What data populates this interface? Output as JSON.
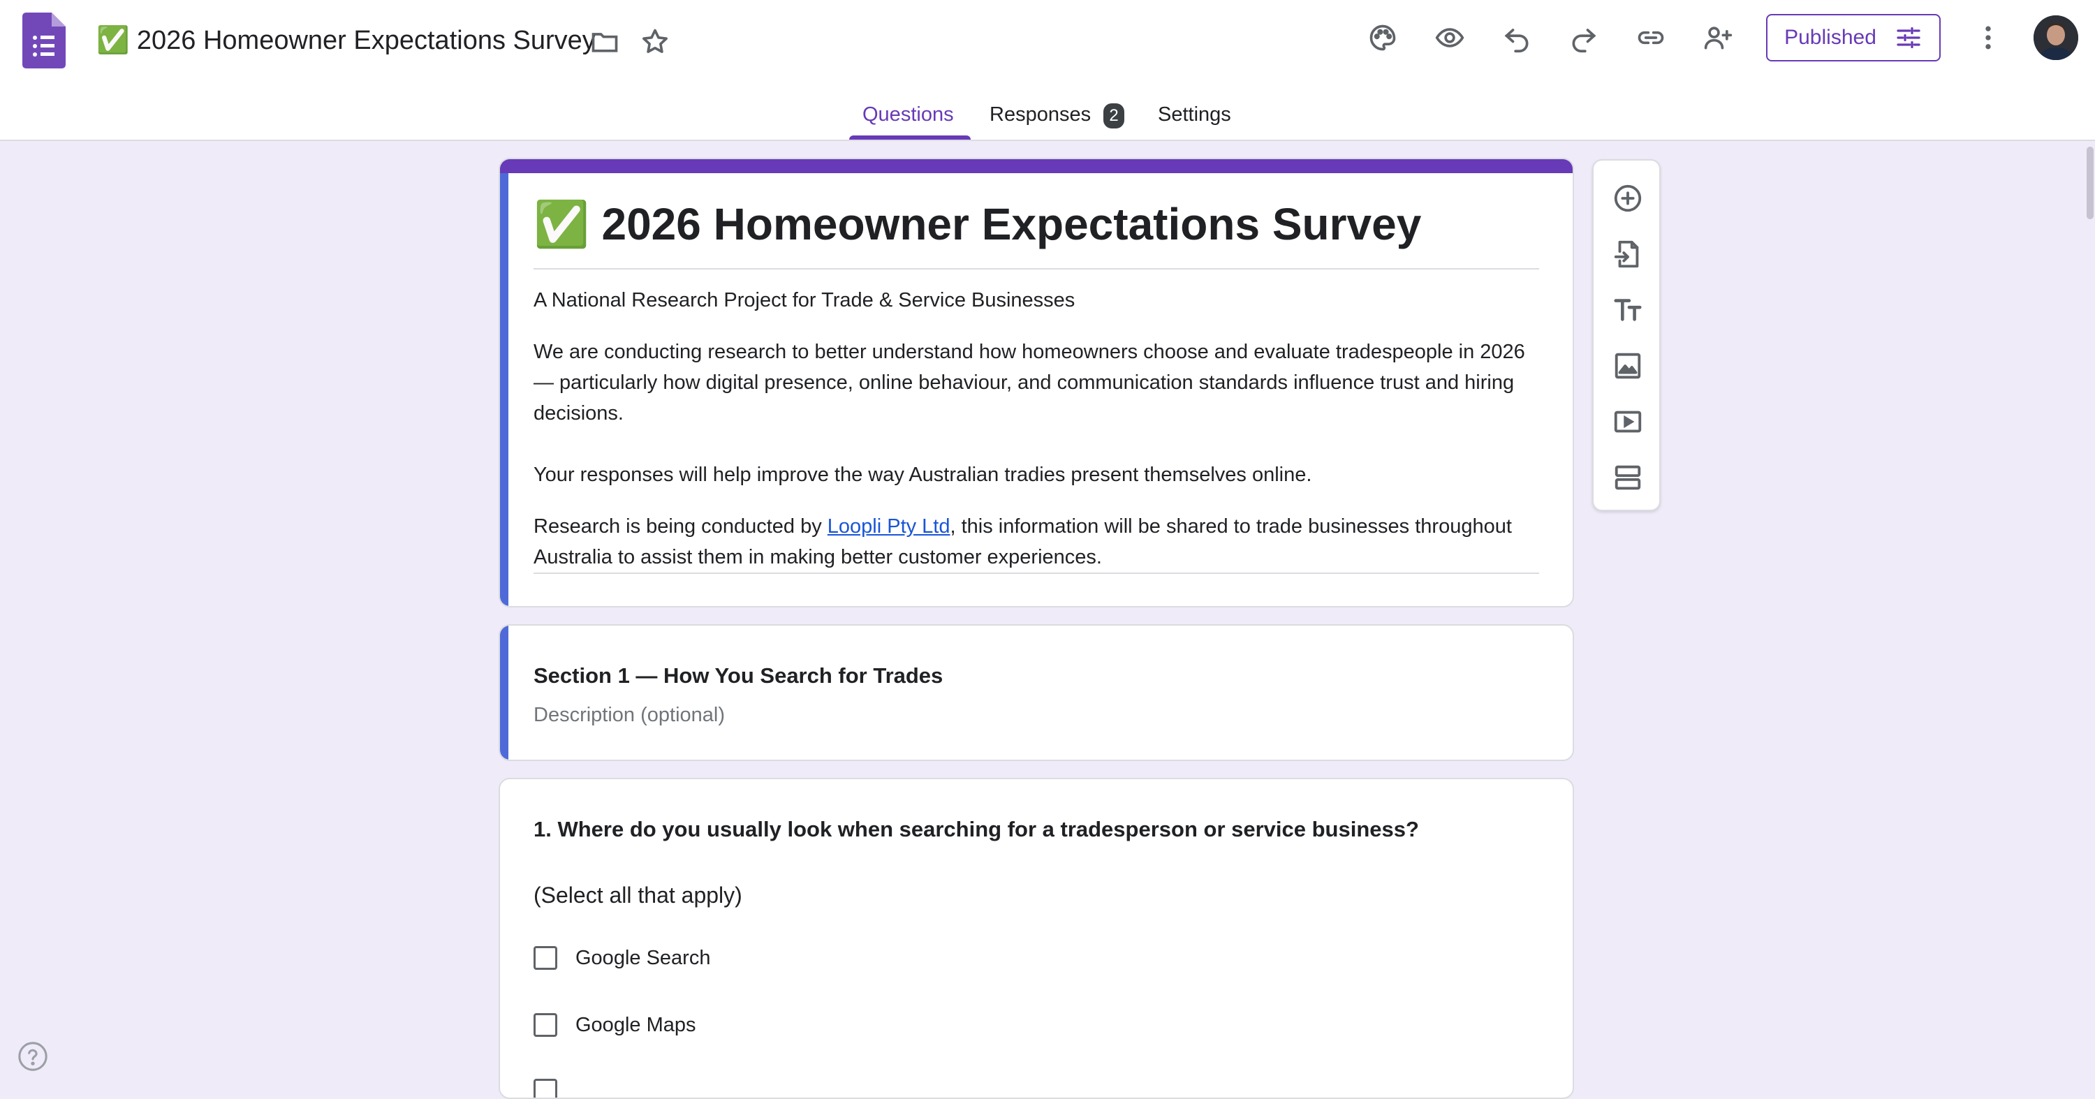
{
  "app": {
    "title": "✅ 2026 Homeowner Expectations Survey",
    "published_label": "Published"
  },
  "tabs": [
    {
      "label": "Questions"
    },
    {
      "label": "Responses"
    },
    {
      "label": "Settings"
    }
  ],
  "responses_count": "2",
  "form": {
    "title": "✅ 2026 Homeowner Expectations Survey",
    "subtitle": "A National Research Project for Trade & Service Businesses",
    "paragraph1": "We are conducting research to better understand how homeowners choose and evaluate tradespeople in 2026 — particularly how digital presence, online behaviour, and communication standards influence trust and hiring decisions.",
    "paragraph2": "Your responses will help improve the way Australian tradies present themselves online.",
    "paragraph3_before": "Research is being conducted by ",
    "paragraph3_link": "Loopli Pty Ltd",
    "paragraph3_after": ", this information will be shared to trade businesses throughout Australia to assist them in making better customer experiences."
  },
  "section": {
    "title": "Section 1 — How You Search for Trades",
    "description_placeholder": "Description (optional)"
  },
  "question1": {
    "title": "1. Where do you usually look when searching for a tradesperson or service business?",
    "subtitle": "(Select all that apply)",
    "options": [
      {
        "label": "Google Search"
      },
      {
        "label": "Google Maps"
      }
    ]
  },
  "colors": {
    "accent": "#673ab7",
    "background": "#f0ebf8",
    "link": "#1a55d6",
    "section_bar": "#4f6ad8"
  },
  "icons": {
    "toolbar": [
      "palette-icon",
      "preview-eye-icon",
      "undo-icon",
      "redo-icon",
      "link-icon",
      "add-collaborator-icon",
      "more-vert-icon"
    ],
    "side_tools": [
      "add-question-icon",
      "import-questions-icon",
      "add-title-icon",
      "add-image-icon",
      "add-video-icon",
      "add-section-icon"
    ]
  }
}
